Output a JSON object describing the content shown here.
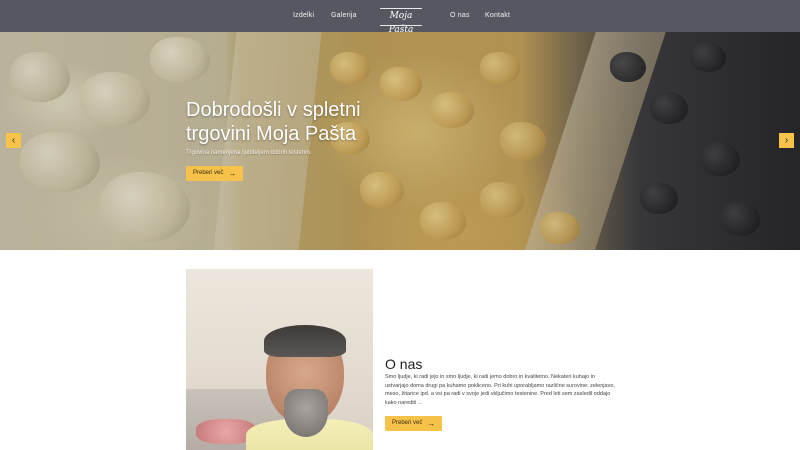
{
  "nav": {
    "items": [
      "Izdelki",
      "Galerija",
      "O nas",
      "Kontakt"
    ],
    "logo": "Moja Pašta"
  },
  "hero": {
    "title": "Dobrodošli v spletni trgovini Moja Pašta",
    "subtitle": "Trgovina namenjena ljubiteljem dobrih testenin.",
    "button_label": "Preberi več",
    "prev_icon": "chevron-left",
    "next_icon": "chevron-right"
  },
  "about": {
    "title": "O nas",
    "text": "Smo ljudje, ki radi jejo in smo ljudje, ki radi jemo dobro in kvalitetno. Nekateri kuhajo in ustvarjajo doma drugi pa kuhamo pokliceno. Pri kuhi uporabljamo različne surovine: zelenjavo, meso, žitarice ipd. a vsi pa radi v svoje jedi vključimo testenine. Pred leti sem zasledil oddajo kako narediti ...",
    "button_label": "Preberi več"
  },
  "colors": {
    "nav_bg": "#555860",
    "accent": "#f6c24a"
  }
}
